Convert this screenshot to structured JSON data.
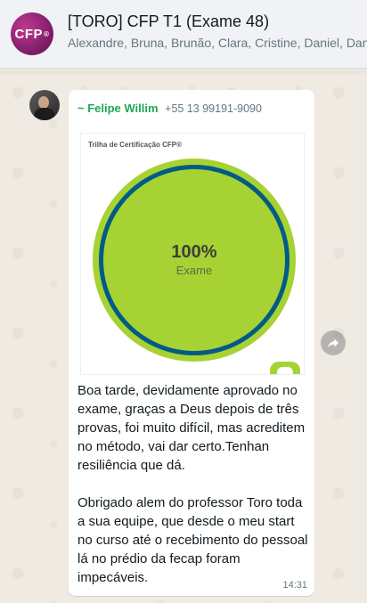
{
  "header": {
    "title": "[TORO] CFP T1 (Exame 48)",
    "members": "Alexandre, Bruna, Brunão, Clara, Cristine, Daniel, Dan",
    "avatar_text": "CFP",
    "avatar_mark": "®"
  },
  "message": {
    "sender_name": "~ Felipe Willim",
    "sender_phone": "+55 13 99191-9090",
    "image": {
      "card_title": "Trilha de Certificação CFP®",
      "progress_percent": "100%",
      "progress_label": "Exame"
    },
    "text": "Boa tarde, devidamente aprovado no exame, graças a Deus depois de três provas, foi muito difícil, mas acreditem no método, vai dar certo.Tenhan resiliência que dá.\n\nObrigado alem do professor Toro toda a sua equipe, que desde o meu start no curso até o recebimento do pessoal lá no prédio da fecap foram impecáveis.",
    "time": "14:31"
  },
  "colors": {
    "sender_name": "#1fa855",
    "ring_green": "#a7d233",
    "ring_blue": "#005b86",
    "avatar_purple": "#9c2a7f"
  },
  "icons": [
    "group-avatar",
    "forward-icon"
  ]
}
